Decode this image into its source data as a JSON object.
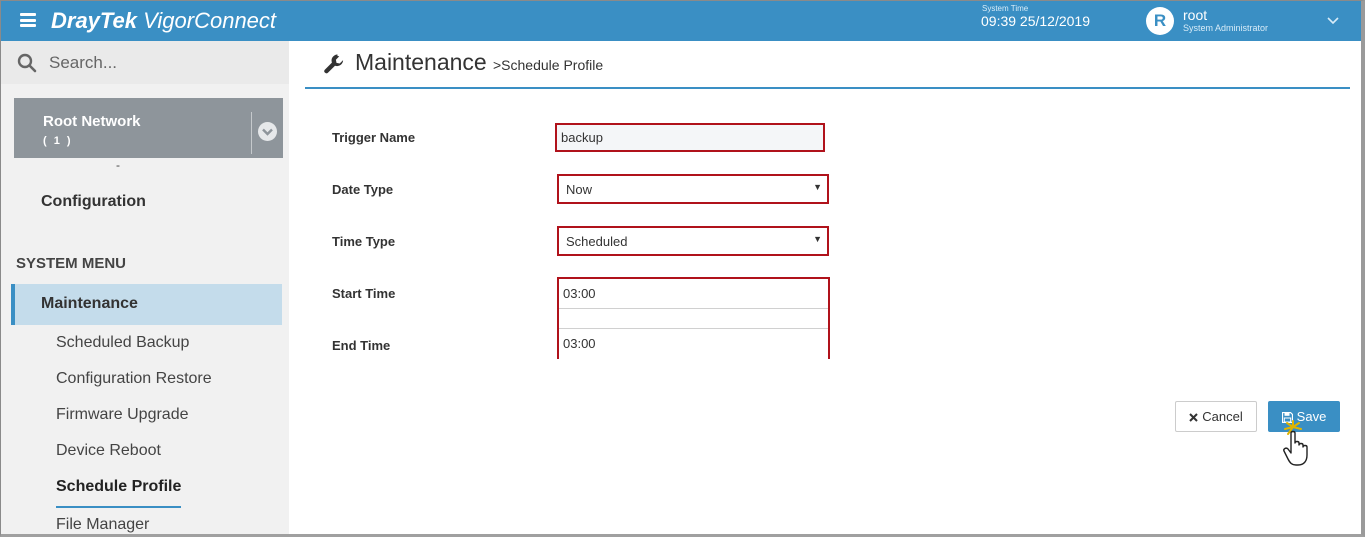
{
  "topbar": {
    "brand_bold": "DrayTek",
    "brand_rest": " VigorConnect",
    "system_time_label": "System Time",
    "system_time": "09:39 25/12/2019",
    "avatar_letter": "R",
    "user_name": "root",
    "user_role": "System Administrator"
  },
  "sidebar": {
    "search_placeholder": "Search...",
    "network": {
      "name": "Root Network",
      "count": "( 1 )"
    },
    "dash": "-",
    "configuration": "Configuration",
    "system_menu_heading": "SYSTEM MENU",
    "active_section": "Maintenance",
    "sub_items": [
      "Scheduled Backup",
      "Configuration Restore",
      "Firmware Upgrade",
      "Device Reboot",
      "Schedule Profile",
      "File Manager"
    ],
    "active_sub_index": 4
  },
  "main": {
    "title": "Maintenance",
    "breadcrumb": ">Schedule Profile",
    "form": {
      "trigger_name_label": "Trigger Name",
      "trigger_name_value": "backup",
      "date_type_label": "Date Type",
      "date_type_value": "Now",
      "time_type_label": "Time Type",
      "time_type_value": "Scheduled",
      "start_time_label": "Start Time",
      "start_time_value": "03:00",
      "end_time_label": "End Time",
      "end_time_value": "03:00"
    },
    "buttons": {
      "cancel": "Cancel",
      "save": "Save"
    }
  },
  "colors": {
    "brand_blue": "#3a8fc4",
    "highlight_red": "#b0121b",
    "sidebar_bg": "#f1f1f1",
    "active_item_bg": "#c4dceb"
  }
}
